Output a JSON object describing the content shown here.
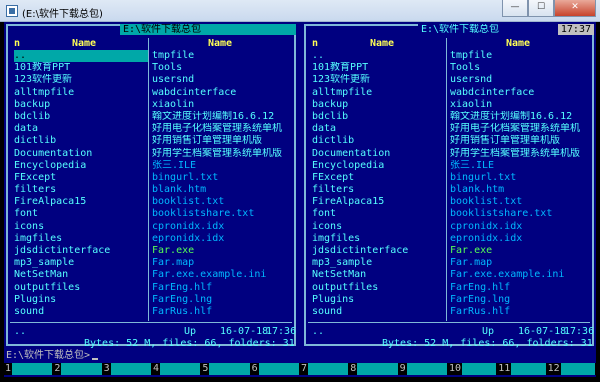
{
  "window": {
    "title": "(E:\\软件下载总包)",
    "buttons": {
      "minimize": "—",
      "maximize": "☐",
      "close": "✕"
    }
  },
  "left_panel": {
    "path": "E:\\软件下载总包",
    "col_header_n": "n",
    "col_header_name": "Name",
    "col1": [
      "..",
      "101教育PPT",
      "123软件更新",
      "alltmpfile",
      "backup",
      "bdclib",
      "data",
      "dictlib",
      "Documentation",
      "Encyclopedia",
      "FExcept",
      "filters",
      "FireAlpaca15",
      "font",
      "icons",
      "imgfiles",
      "jdsdictinterface",
      "mp3_sample",
      "NetSetMan",
      "outputfiles",
      "Plugins",
      "sound"
    ],
    "col2": [
      "tmpfile",
      "Tools",
      "usersnd",
      "wabdcinterface",
      "xiaolin",
      "翰文进度计划编制16.6.12",
      "好用电子化档案管理系统单机",
      "好用销售订单管理单机版",
      "好用学生档案管理系统单机版",
      "张三.ILE",
      "bingurl.txt",
      "blank.htm",
      "booklist.txt",
      "booklistshare.txt",
      "cpronidx.idx",
      "epronidx.idx",
      "Far.exe",
      "Far.map",
      "Far.exe.example.ini",
      "FarEng.hlf",
      "FarEng.lng",
      "FarRus.hlf"
    ],
    "status_name": "..",
    "status_up": "Up",
    "status_date": "16-07-18",
    "status_time": "17:36",
    "summary": "Bytes: 52 M, files: 66, folders: 31"
  },
  "right_panel": {
    "path": "E:\\软件下载总包",
    "clock": "17:37",
    "col_header_n": "n",
    "col_header_name": "Name",
    "col1": [
      "..",
      "101教育PPT",
      "123软件更新",
      "alltmpfile",
      "backup",
      "bdclib",
      "data",
      "dictlib",
      "Documentation",
      "Encyclopedia",
      "FExcept",
      "filters",
      "FireAlpaca15",
      "font",
      "icons",
      "imgfiles",
      "jdsdictinterface",
      "mp3_sample",
      "NetSetMan",
      "outputfiles",
      "Plugins",
      "sound"
    ],
    "col2": [
      "tmpfile",
      "Tools",
      "usersnd",
      "wabdcinterface",
      "xiaolin",
      "翰文进度计划编制16.6.12",
      "好用电子化档案管理系统单机",
      "好用销售订单管理单机版",
      "好用学生档案管理系统单机版",
      "张三.ILE",
      "bingurl.txt",
      "blank.htm",
      "booklist.txt",
      "booklistshare.txt",
      "cpronidx.idx",
      "epronidx.idx",
      "Far.exe",
      "Far.map",
      "Far.exe.example.ini",
      "FarEng.hlf",
      "FarEng.lng",
      "FarRus.hlf"
    ],
    "status_name": "..",
    "status_up": "Up",
    "status_date": "16-07-18",
    "status_time": "17:36",
    "summary": "Bytes: 52 M, files: 66, folders: 31"
  },
  "prompt": "E:\\软件下载总包>",
  "keybar": [
    "1",
    "2",
    "3",
    "4",
    "5",
    "6",
    "7",
    "8",
    "9",
    "10",
    "11",
    "12"
  ],
  "colors": {
    "panel_bg": "#000080",
    "frame": "#7fb8d8",
    "file_text": "#55ffff",
    "header_text": "#ffff55",
    "selection": "#00a8a8",
    "executable": "#55ff55",
    "text_file": "#00b8ff"
  }
}
